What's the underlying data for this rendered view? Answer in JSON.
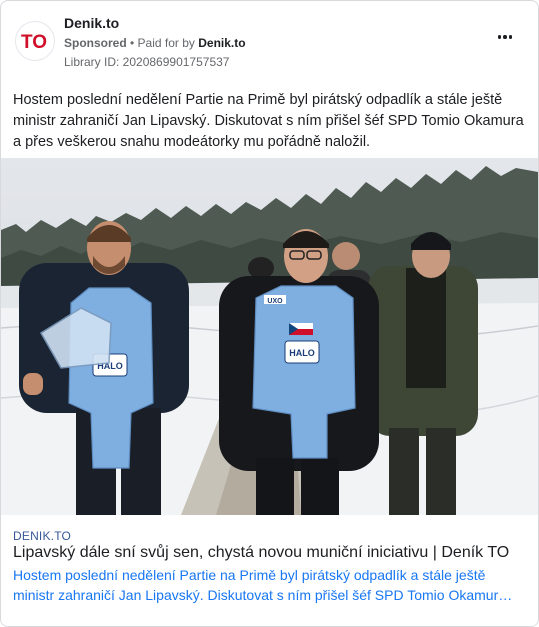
{
  "post": {
    "page_name": "Denik.to",
    "sponsored_label": "Sponsored",
    "separator": " • ",
    "paid_for_prefix": "Paid for by ",
    "paid_for_by": "Denik.to",
    "library_id": "Library ID: 2020869901757537",
    "avatar_text": "TO",
    "body": "Hostem poslední nedělení Partie na Primě byl pirátský odpadlík a stále ještě ministr zahraničí Jan Lipavský. Diskutovat s ním přišel šéf SPD Tomio Okamura a přes veškerou snahu modeátorky mu pořádně naložil."
  },
  "photo": {
    "vest_badge": "HALO",
    "vest_badge_sub": "TRUST",
    "vest_patch_text": "UXO"
  },
  "link": {
    "domain": "DENIK.TO",
    "headline": "Lipavský dále sní svůj sen, chystá novou muniční iniciativu | Deník TO",
    "description": "Hostem poslední nedělení Partie na Primě byl pirátský odpadlík a stále ještě ministr zahraničí Jan Lipavský. Diskutovat s ním přišel šéf SPD Tomio Okamura a přes veškerou snahu modeátorky mu pořádně naložil."
  },
  "colors": {
    "brand_red": "#d0102a",
    "vest_blue": "#7faee0",
    "link_blue": "#1877f2",
    "muted": "#65676b"
  },
  "icons": {
    "more": "more-horizontal-icon",
    "avatar": "denik-to-logo"
  }
}
